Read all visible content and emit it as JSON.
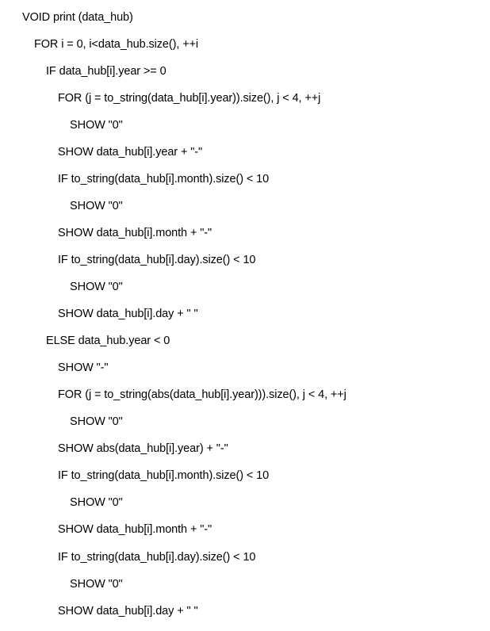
{
  "lines": [
    "VOID print (data_hub)",
    "FOR i = 0, i<data_hub.size(), ++i",
    "IF data_hub[i].year >= 0",
    "FOR (j = to_string(data_hub[i].year)).size(), j < 4, ++j",
    "SHOW \"0\"",
    "SHOW data_hub[i].year + \"-\"",
    "IF to_string(data_hub[i].month).size() < 10",
    "SHOW \"0\"",
    "SHOW data_hub[i].month + \"-\"",
    "IF to_string(data_hub[i].day).size() < 10",
    "SHOW \"0\"",
    "SHOW data_hub[i].day + \" \"",
    "ELSE data_hub.year < 0",
    "SHOW \"-\"",
    "FOR (j = to_string(abs(data_hub[i].year))).size(), j < 4, ++j",
    "SHOW \"0\"",
    "SHOW abs(data_hub[i].year) + \"-\"",
    "IF to_string(data_hub[i].month).size() < 10",
    "SHOW \"0\"",
    "SHOW data_hub[i].month + \"-\"",
    "IF to_string(data_hub[i].day).size() < 10",
    "SHOW \"0\"",
    "SHOW data_hub[i].day + \" \""
  ]
}
